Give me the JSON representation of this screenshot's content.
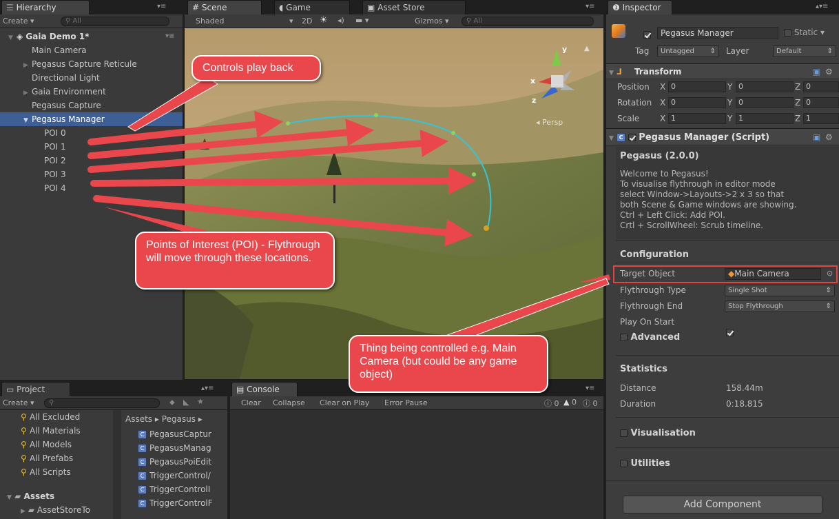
{
  "hierarchy": {
    "tab_label": "Hierarchy",
    "create_label": "Create ▾",
    "search_placeholder": "All",
    "scene_name": "Gaia Demo 1*",
    "items": [
      {
        "label": "Main Camera"
      },
      {
        "label": "Pegasus Capture Reticule"
      },
      {
        "label": "Directional Light"
      },
      {
        "label": "Gaia Environment"
      },
      {
        "label": "Pegasus Capture"
      },
      {
        "label": "Pegasus Manager"
      },
      {
        "label": "POI 0"
      },
      {
        "label": "POI 1"
      },
      {
        "label": "POI 2"
      },
      {
        "label": "POI 3"
      },
      {
        "label": "POI 4"
      }
    ]
  },
  "scene": {
    "tab_scene": "Scene",
    "tab_game": "Game",
    "tab_asset_store": "Asset Store",
    "shading_mode": "Shaded",
    "mode_2d": "2D",
    "gizmos_label": "Gizmos ▾",
    "search_placeholder": "All",
    "persp_label": "Persp",
    "gizmo_y": "y",
    "gizmo_x": "x",
    "gizmo_z": "z"
  },
  "inspector": {
    "tab_label": "Inspector",
    "object_name": "Pegasus Manager",
    "static_label": "Static",
    "tag_label": "Tag",
    "tag_value": "Untagged",
    "layer_label": "Layer",
    "layer_value": "Default",
    "transform": {
      "title": "Transform",
      "rows": [
        {
          "label": "Position",
          "x": "0",
          "y": "0",
          "z": "0"
        },
        {
          "label": "Rotation",
          "x": "0",
          "y": "0",
          "z": "0"
        },
        {
          "label": "Scale",
          "x": "1",
          "y": "1",
          "z": "1"
        }
      ],
      "axis_x": "X",
      "axis_y": "Y",
      "axis_z": "Z"
    },
    "script": {
      "title": "Pegasus Manager (Script)",
      "version": "Pegasus (2.0.0)",
      "welcome_lines": [
        "Welcome to Pegasus!",
        "To visualise flythrough in editor mode",
        "select Window->Layouts->2 x 3 so that",
        "both Scene & Game windows are showing.",
        "Ctrl + Left Click: Add POI.",
        "Crtl + ScrollWheel: Scrub timeline."
      ],
      "configuration_header": "Configuration",
      "target_object_label": "Target Object",
      "target_object_value": "Main Camera",
      "flythrough_type_label": "Flythrough Type",
      "flythrough_type_value": "Single Shot",
      "flythrough_end_label": "Flythrough End",
      "flythrough_end_value": "Stop Flythrough",
      "play_on_start_label": "Play On Start",
      "advanced_label": "Advanced",
      "statistics_header": "Statistics",
      "distance_label": "Distance",
      "distance_value": "158.44m",
      "duration_label": "Duration",
      "duration_value": "0:18.815",
      "visualisation_label": "Visualisation",
      "utilities_label": "Utilities"
    },
    "add_component_label": "Add Component"
  },
  "project": {
    "tab_label": "Project",
    "create_label": "Create ▾",
    "favorites": [
      "All Excluded",
      "All Materials",
      "All Models",
      "All Prefabs",
      "All Scripts"
    ],
    "assets_label": "Assets",
    "asset_store_folder": "AssetStoreTo",
    "breadcrumb": "Assets ▸ Pegasus ▸",
    "files": [
      "PegasusCaptur",
      "PegasusManag",
      "PegasusPoiEdit",
      "TriggerControl/",
      "TriggerControlI",
      "TriggerControlF"
    ]
  },
  "console": {
    "tab_label": "Console",
    "clear": "Clear",
    "collapse": "Collapse",
    "clear_on_play": "Clear on Play",
    "error_pause": "Error Pause",
    "info_count": "0",
    "warn_count": "0",
    "error_count": "0"
  },
  "annotations": {
    "controls_playback": "Controls play back",
    "poi_note": "Points of Interest (POI) - Flythrough will move through these locations.",
    "thing_controlled": "Thing being controlled e.g. Main Camera (but could be any game object)"
  },
  "colors": {
    "callout_fill": "#e9474c",
    "selection_blue": "#3e5f96",
    "highlight_box": "#e0453f",
    "spline": "#34c4d8"
  }
}
